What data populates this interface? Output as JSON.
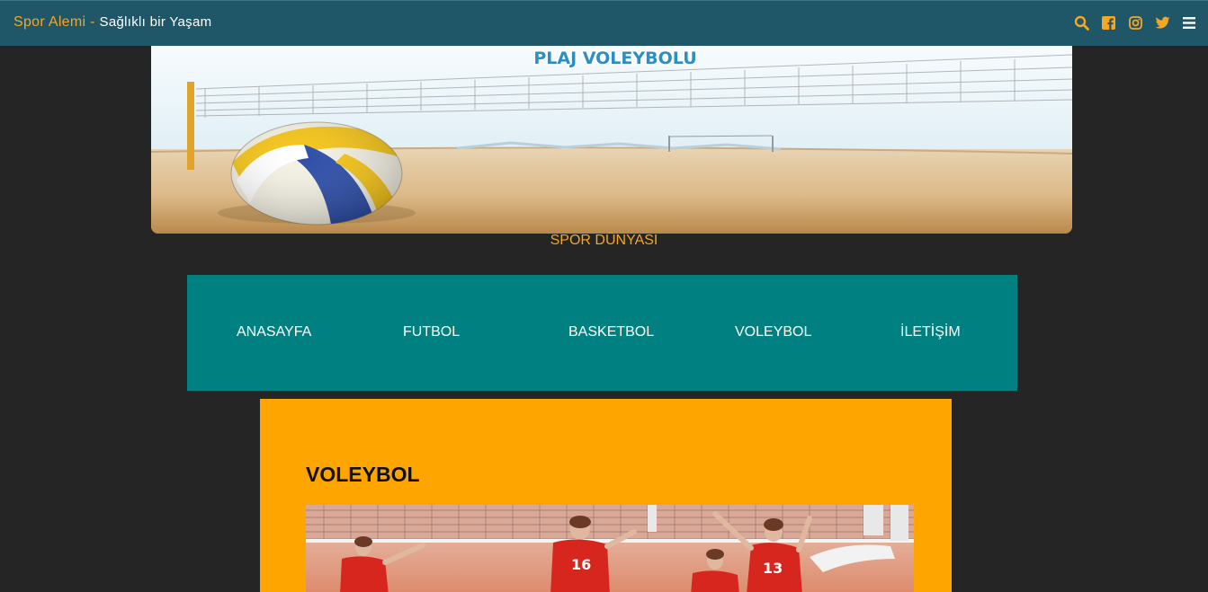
{
  "header": {
    "brand_name": "Spor Alemi",
    "brand_separator": "-",
    "tagline": "Sağlıklı bir Yaşam",
    "icons": [
      "search-icon",
      "facebook-icon",
      "instagram-icon",
      "twitter-icon",
      "menu-icon"
    ],
    "accent_color": "#f5a623",
    "bar_color": "#1f5768"
  },
  "hero": {
    "banner_text": "PLAJ VOLEYBOLU"
  },
  "subtitle": "SPOR DÜNYASI",
  "nav": {
    "items": [
      {
        "label": "ANASAYFA"
      },
      {
        "label": "FUTBOL"
      },
      {
        "label": "BASKETBOL"
      },
      {
        "label": "VOLEYBOL"
      },
      {
        "label": "İLETİŞİM"
      }
    ],
    "color": "#008080"
  },
  "content": {
    "title": "VOLEYBOL",
    "card_color": "#ffa500"
  }
}
